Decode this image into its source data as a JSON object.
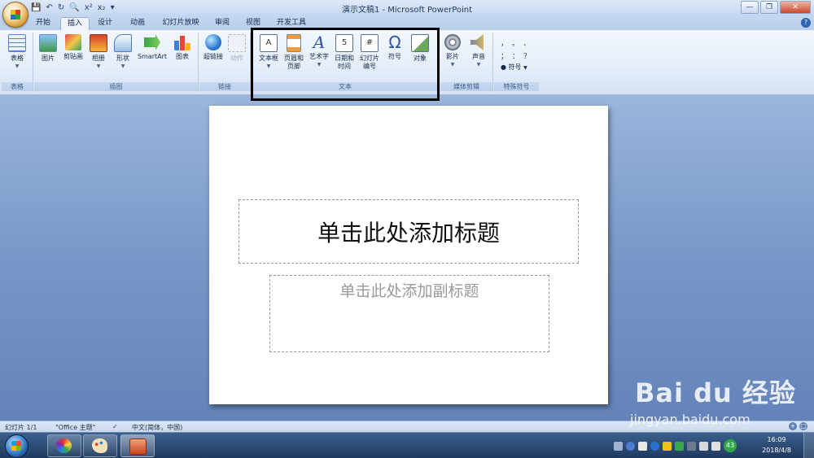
{
  "window": {
    "title": "演示文稿1 - Microsoft PowerPoint"
  },
  "qat": {
    "icons": [
      "save-icon",
      "undo-icon",
      "redo-icon",
      "print-preview-icon",
      "superscript-icon",
      "subscript-icon",
      "customize-icon"
    ],
    "superscript_label": "x²",
    "subscript_label": "x₂"
  },
  "tabs": [
    "开始",
    "插入",
    "设计",
    "动画",
    "幻灯片放映",
    "审阅",
    "视图",
    "开发工具"
  ],
  "active_tab": "插入",
  "ribbon": {
    "groups": {
      "table": "表格",
      "illustrations": "插图",
      "links": "链接",
      "text": "文本",
      "media": "媒体剪辑",
      "special": "特殊符号"
    },
    "buttons": {
      "table": "表格",
      "picture": "图片",
      "clipart": "剪贴画",
      "album": "相册",
      "shapes": "形状",
      "smartart": "SmartArt",
      "chart": "图表",
      "hyperlink": "超链接",
      "action": "动作",
      "textbox": "文本框",
      "header_footer_1": "页眉和",
      "header_footer_2": "页脚",
      "wordart": "艺术字",
      "datetime_1": "日期和",
      "datetime_2": "时间",
      "slidenum_1": "幻灯片",
      "slidenum_2": "编号",
      "symbol": "符号",
      "object": "对象",
      "movie": "影片",
      "sound": "声音",
      "special_symbol": "符号"
    },
    "special_glyphs": [
      "，",
      "。",
      "、",
      "；",
      "：",
      "？"
    ]
  },
  "slide": {
    "title_placeholder": "单击此处添加标题",
    "subtitle_placeholder": "单击此处添加副标题"
  },
  "statusbar": {
    "slide_count": "幻灯片 1/1",
    "theme": "\"Office 主题\"",
    "language": "中文(简体，中国)"
  },
  "watermark": {
    "text": "Bai du 经验",
    "url": "jingyan.baidu.com"
  },
  "taskbar": {
    "tray_number": "43",
    "time": "16:09",
    "date": "2018/4/8"
  },
  "colors": {
    "ribbon_bg": "#e4edf9",
    "accent": "#2d62b5",
    "highlight_box": "#000000"
  }
}
